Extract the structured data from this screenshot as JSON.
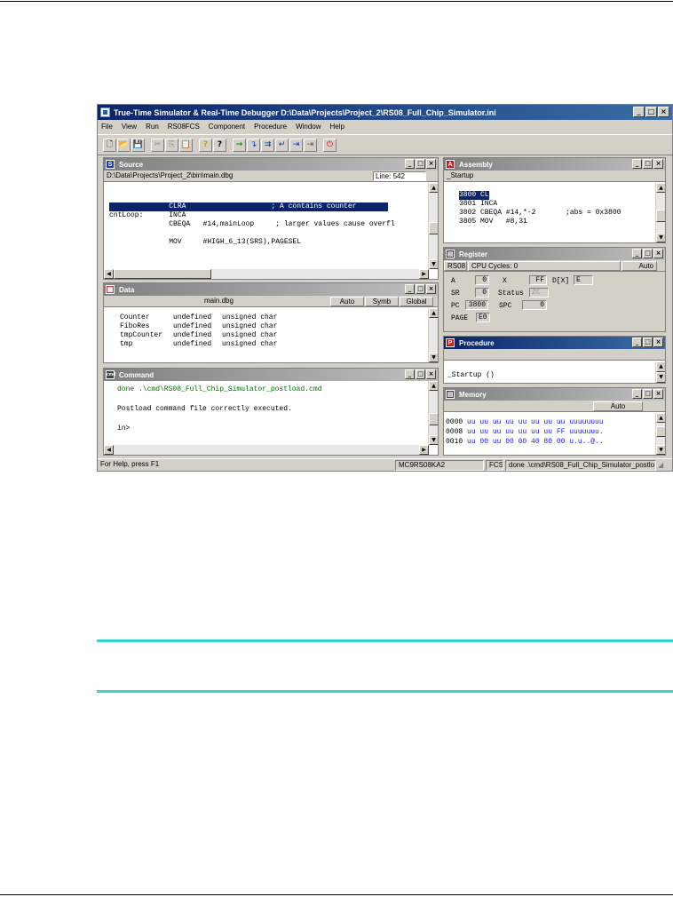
{
  "app": {
    "title": "True-Time Simulator & Real-Time Debugger  D:\\Data\\Projects\\Project_2\\RS08_Full_Chip_Simulator.ini",
    "menu": [
      "File",
      "View",
      "Run",
      "RS08FCS",
      "Component",
      "Procedure",
      "Window",
      "Help"
    ],
    "window_buttons": [
      "_",
      "□",
      "×"
    ]
  },
  "toolbar": {
    "icons": [
      "new-file",
      "open-folder",
      "save",
      "cut",
      "copy",
      "paste",
      "help",
      "context-help",
      "start",
      "single-step",
      "step-over",
      "step-out",
      "assembly-step",
      "halt",
      "reset"
    ],
    "glyphs": [
      "🗋",
      "📂",
      "💾",
      "✂",
      "⎘",
      "📋",
      "?",
      "?",
      "→",
      "↴",
      "⇉",
      "↵",
      "⇥",
      "⇥",
      "⏻"
    ]
  },
  "source": {
    "title": "Source",
    "icon": "S",
    "path": "D:\\Data\\Projects\\Project_2\\bin\\main.dbg",
    "line": "Line: 542",
    "lines": [
      "",
      "",
      "              CLRA                    ; A contains counter",
      "cntLoop:      INCA",
      "              CBEQA   #14,mainLoop     ; larger values cause overfl",
      "",
      "              MOV     #HIGH_6_13(SRS),PAGESEL"
    ]
  },
  "assembly": {
    "title": "Assembly",
    "icon": "A",
    "label": "_Startup",
    "lines": [
      "3800 CLRA",
      "3801 INCA",
      "3802 CBEQA #14,*-2       ;abs = 0x3800",
      "3805 MOV   #8,31"
    ]
  },
  "register": {
    "title": "Register",
    "cpu": "RS08",
    "cycles": "CPU Cycles: 0",
    "mode": "Auto",
    "labels": {
      "a": "A",
      "x": "X",
      "dx": "D[X]",
      "sr": "SR",
      "status": "Status",
      "pc": "PC",
      "spc": "SPC",
      "page": "PAGE"
    },
    "values": {
      "a": "0",
      "x": "FF",
      "dx": "E",
      "sr": "0",
      "status": "ZC",
      "pc": "3800",
      "spc": "0",
      "page": "E0"
    }
  },
  "data": {
    "title": "Data",
    "file": "main.dbg",
    "cols": [
      "Auto",
      "Symb",
      "Global"
    ],
    "rows": [
      [
        "Counter",
        "undefined",
        "unsigned char"
      ],
      [
        "FiboRes",
        "undefined",
        "unsigned char"
      ],
      [
        "tmpCounter",
        "undefined",
        "unsigned char"
      ],
      [
        "tmp",
        "undefined",
        "unsigned char"
      ]
    ]
  },
  "procedure": {
    "title": "Procedure",
    "icon": "P",
    "item": "_Startup ()"
  },
  "command": {
    "title": "Command",
    "icon": "cmd",
    "lines": [
      "done .\\cmd\\RS08_Full_Chip_Simulator_postload.cmd",
      "",
      "Postload command file correctly executed.",
      "",
      "in>"
    ]
  },
  "memory": {
    "title": "Memory",
    "mode": "Auto",
    "rows": [
      {
        "addr": "0000",
        "bytes": "uu uu uu uu uu uu uu uu",
        "ascii": "uuuuuuuu"
      },
      {
        "addr": "0008",
        "bytes": "uu uu uu uu uu uu uu FF",
        "ascii": "uuuuuuu."
      },
      {
        "addr": "0010",
        "bytes": "uu 00 uu 00 00 40 80 00",
        "ascii": "u.u..@.."
      }
    ]
  },
  "status": {
    "help": "For Help, press F1",
    "device": "MC9RS08KA2",
    "target": "FCS",
    "message": "done .\\cmd\\RS08_Full_Chip_Simulator_postlo"
  },
  "colors": {
    "selection": "#0a246a",
    "cmd_text": "#007000",
    "mem_text": "#1a1aff",
    "accent_rule": "#33d6cc"
  }
}
